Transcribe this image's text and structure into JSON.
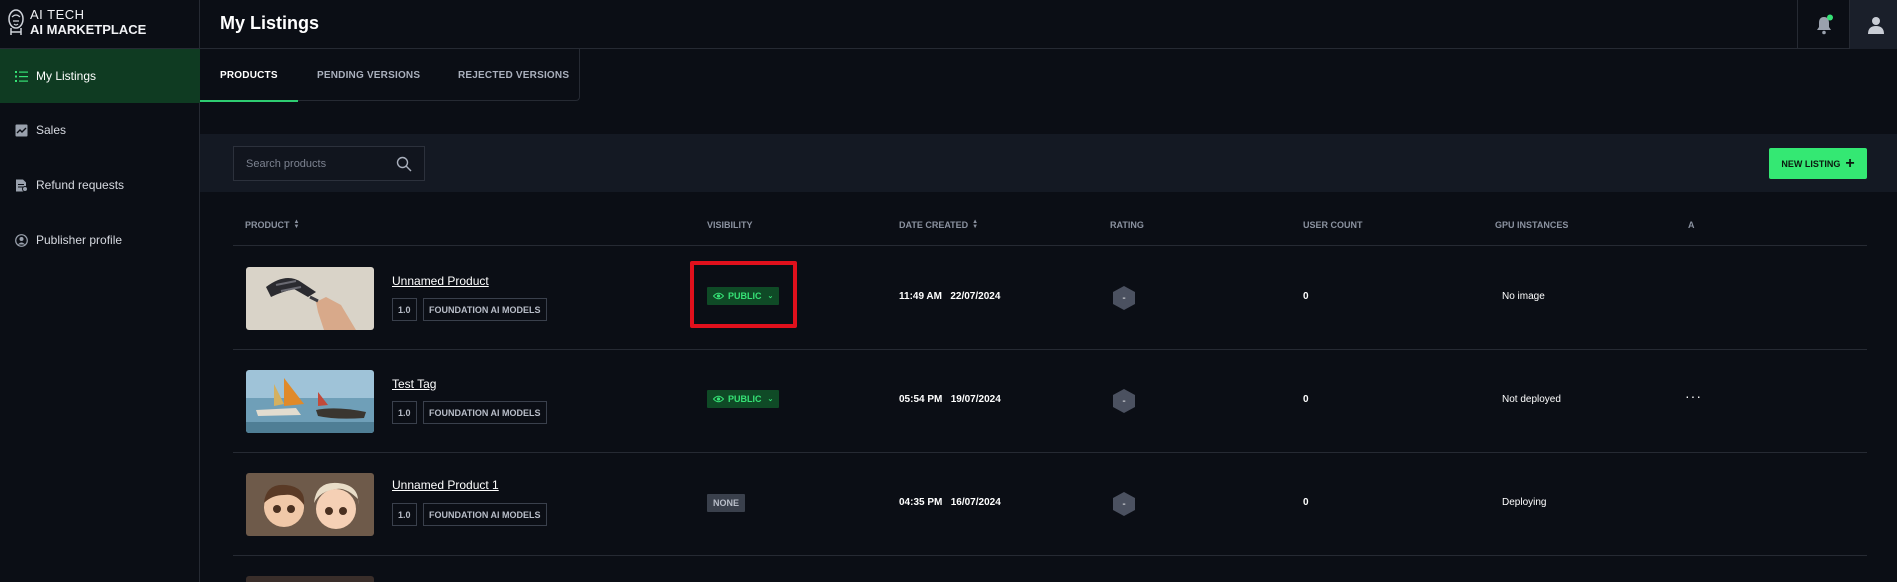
{
  "brand": {
    "line1": "AI TECH",
    "line2": "AI MARKETPLACE"
  },
  "sidebar": {
    "items": [
      {
        "label": "My Listings",
        "icon": "list-icon",
        "active": true
      },
      {
        "label": "Sales",
        "icon": "chart-icon",
        "active": false
      },
      {
        "label": "Refund requests",
        "icon": "refund-icon",
        "active": false
      },
      {
        "label": "Publisher profile",
        "icon": "profile-icon",
        "active": false
      }
    ]
  },
  "header": {
    "title": "My Listings"
  },
  "tabs": [
    {
      "label": "PRODUCTS",
      "active": true
    },
    {
      "label": "PENDING VERSIONS",
      "active": false
    },
    {
      "label": "REJECTED VERSIONS",
      "active": false
    }
  ],
  "toolbar": {
    "search_placeholder": "Search products",
    "new_listing_label": "NEW LISTING"
  },
  "table": {
    "columns": [
      "PRODUCT",
      "VISIBILITY",
      "DATE CREATED",
      "RATING",
      "USER COUNT",
      "GPU INSTANCES",
      "A"
    ],
    "rows": [
      {
        "name": "Unnamed Product",
        "version": "1.0",
        "category": "FOUNDATION AI MODELS",
        "visibility": "PUBLIC",
        "time": "11:49 AM",
        "date": "22/07/2024",
        "rating": "-",
        "user_count": "0",
        "gpu": "No image",
        "has_actions": false
      },
      {
        "name": "Test Tag",
        "version": "1.0",
        "category": "FOUNDATION AI MODELS",
        "visibility": "PUBLIC",
        "time": "05:54 PM",
        "date": "19/07/2024",
        "rating": "-",
        "user_count": "0",
        "gpu": "Not deployed",
        "has_actions": true,
        "actions": "···"
      },
      {
        "name": "Unnamed Product 1",
        "version": "1.0",
        "category": "FOUNDATION AI MODELS",
        "visibility": "NONE",
        "time": "04:35 PM",
        "date": "16/07/2024",
        "rating": "-",
        "user_count": "0",
        "gpu": "Deploying",
        "has_actions": false
      }
    ]
  },
  "colors": {
    "accent": "#34e873",
    "active_nav": "#0f3b22",
    "highlight": "#e0101c"
  }
}
